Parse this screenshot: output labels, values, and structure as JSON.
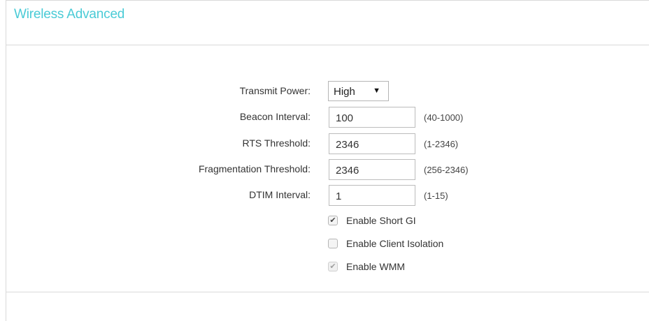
{
  "panel": {
    "title": "Wireless Advanced"
  },
  "form": {
    "transmit_power": {
      "label": "Transmit Power:",
      "value": "High",
      "arrow": "▼"
    },
    "beacon_interval": {
      "label": "Beacon Interval:",
      "value": "100",
      "range": "(40-1000)"
    },
    "rts_threshold": {
      "label": "RTS Threshold:",
      "value": "2346",
      "range": "(1-2346)"
    },
    "fragmentation_threshold": {
      "label": "Fragmentation Threshold:",
      "value": "2346",
      "range": "(256-2346)"
    },
    "dtim_interval": {
      "label": "DTIM Interval:",
      "value": "1",
      "range": "(1-15)"
    }
  },
  "checkboxes": {
    "short_gi": {
      "label": "Enable Short GI",
      "checked": true,
      "enabled": true,
      "mark": "✔"
    },
    "client_isolation": {
      "label": "Enable Client Isolation",
      "checked": false,
      "enabled": true,
      "mark": ""
    },
    "wmm": {
      "label": "Enable WMM",
      "checked": true,
      "enabled": false,
      "mark": "✔"
    }
  },
  "colors": {
    "title": "#4acbd6",
    "border": "#d9d9d9"
  }
}
